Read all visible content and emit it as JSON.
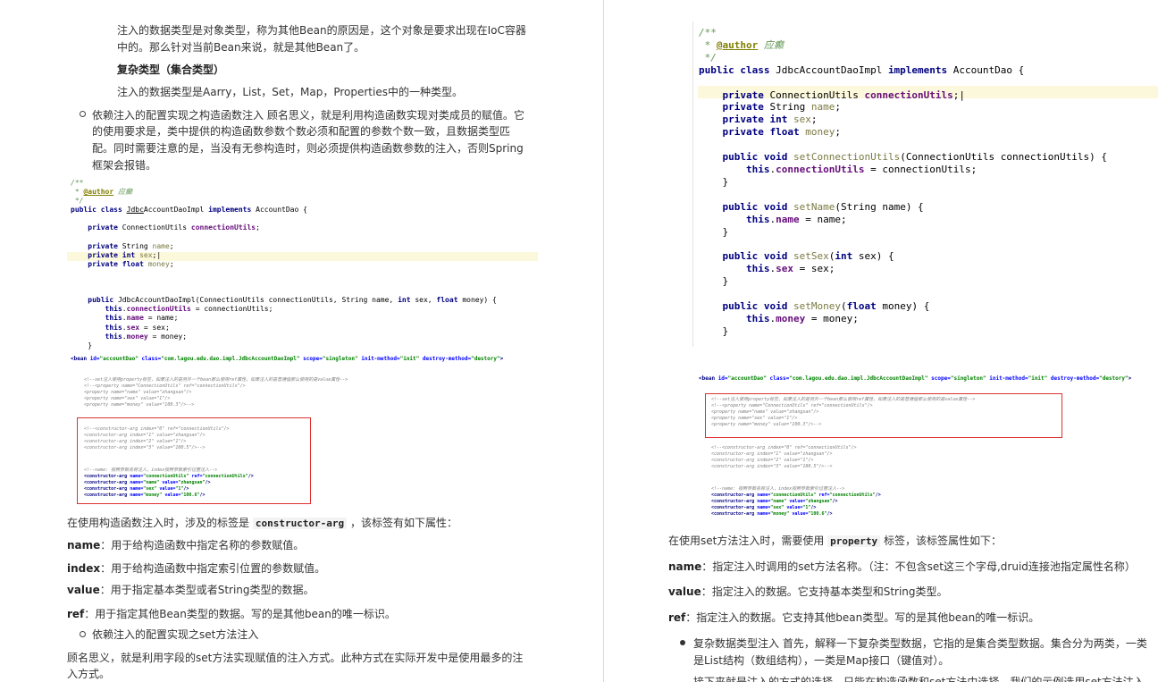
{
  "left": {
    "p1": "注入的数据类型是对象类型，称为其他Bean的原因是，这个对象是要求出现在IoC容器",
    "p1b": "中的。那么针对当前Bean来说，就是其他Bean了。",
    "heading": "复杂类型（集合类型）",
    "p2": "注入的数据类型是Aarry，List，Set，Map，Properties中的一种类型。",
    "b1": "依赖注入的配置实现之构造函数注入 顾名思义，就是利用构造函数实现对类成员的赋值。它",
    "b1b": "的使用要求是，类中提供的构造函数参数个数必须和配置的参数个数一致，且数据类型匹",
    "b1c": "配。同时需要注意的是，当没有无参构造时，则必须提供构造函数参数的注入，否则Spring",
    "b1d": "框架会报错。",
    "after_pre": "在使用构造函数注入时，涉及的标签是 ",
    "after_code": "constructor-arg",
    "after_post": " ，该标签有如下属性：",
    "props": [
      {
        "name": "name",
        "desc": "：用于给构造函数中指定名称的参数赋值。"
      },
      {
        "name": "index",
        "desc": "：用于给构造函数中指定索引位置的参数赋值。"
      },
      {
        "name": "value",
        "desc": "：用于指定基本类型或者String类型的数据。"
      },
      {
        "name": "ref",
        "desc": "：用于指定其他Bean类型的数据。写的是其他bean的唯一标识。"
      }
    ],
    "b2": "依赖注入的配置实现之set方法注入",
    "p3": "顾名思义，就是利用字段的set方法实现赋值的注入方式。此种方式在实际开发中是使用最多的注",
    "p3b": "入方式。"
  },
  "right": {
    "after_pre": "在使用set方法注入时，需要使用 ",
    "after_code": "property",
    "after_post": " 标签，该标签属性如下：",
    "props": [
      {
        "name": "name",
        "desc": "：指定注入时调用的set方法名称。（注：不包含set这三个字母,druid连接池指定属性名称）"
      },
      {
        "name": "value",
        "desc": "：指定注入的数据。它支持基本类型和String类型。"
      },
      {
        "name": "ref",
        "desc": "：指定注入的数据。它支持其他bean类型。写的是其他bean的唯一标识。"
      }
    ],
    "b1": "复杂数据类型注入 首先，解释一下复杂类型数据，它指的是集合类型数据。集合分为两类，一类",
    "b1b": "是List结构（数组结构），一类是Map接口（键值对）。",
    "b2": "接下来就是注入的方式的选择，只能在构造函数和set方法中选择，我们的示例选用set方法注入。"
  }
}
